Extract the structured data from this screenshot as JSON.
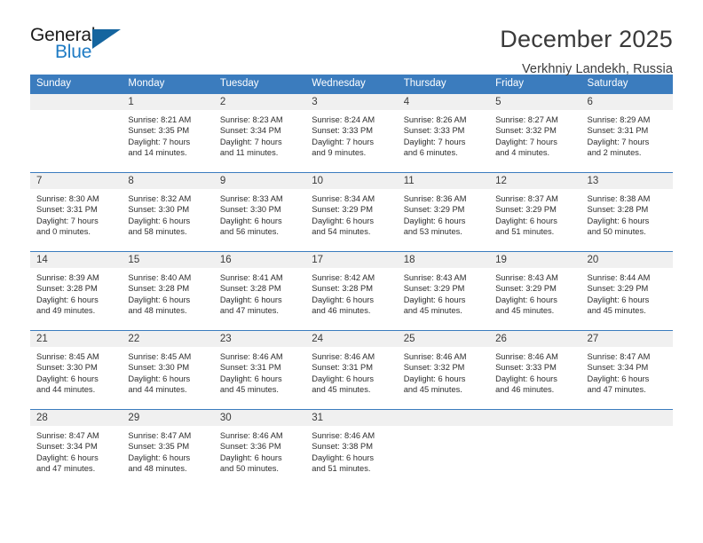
{
  "brand": {
    "name_top": "General",
    "name_bottom": "Blue",
    "accent_color": "#1e7bc4",
    "triangle_color": "#15659f"
  },
  "header": {
    "title": "December 2025",
    "subtitle": "Verkhniy Landekh, Russia"
  },
  "calendar": {
    "header_color": "#3b7cbe",
    "daynum_bg": "#f0f0f0",
    "weekday_names": [
      "Sunday",
      "Monday",
      "Tuesday",
      "Wednesday",
      "Thursday",
      "Friday",
      "Saturday"
    ],
    "weeks": [
      [
        {
          "day": "",
          "sunrise": "",
          "sunset": "",
          "daylight1": "",
          "daylight2": ""
        },
        {
          "day": "1",
          "sunrise": "Sunrise: 8:21 AM",
          "sunset": "Sunset: 3:35 PM",
          "daylight1": "Daylight: 7 hours",
          "daylight2": "and 14 minutes."
        },
        {
          "day": "2",
          "sunrise": "Sunrise: 8:23 AM",
          "sunset": "Sunset: 3:34 PM",
          "daylight1": "Daylight: 7 hours",
          "daylight2": "and 11 minutes."
        },
        {
          "day": "3",
          "sunrise": "Sunrise: 8:24 AM",
          "sunset": "Sunset: 3:33 PM",
          "daylight1": "Daylight: 7 hours",
          "daylight2": "and 9 minutes."
        },
        {
          "day": "4",
          "sunrise": "Sunrise: 8:26 AM",
          "sunset": "Sunset: 3:33 PM",
          "daylight1": "Daylight: 7 hours",
          "daylight2": "and 6 minutes."
        },
        {
          "day": "5",
          "sunrise": "Sunrise: 8:27 AM",
          "sunset": "Sunset: 3:32 PM",
          "daylight1": "Daylight: 7 hours",
          "daylight2": "and 4 minutes."
        },
        {
          "day": "6",
          "sunrise": "Sunrise: 8:29 AM",
          "sunset": "Sunset: 3:31 PM",
          "daylight1": "Daylight: 7 hours",
          "daylight2": "and 2 minutes."
        }
      ],
      [
        {
          "day": "7",
          "sunrise": "Sunrise: 8:30 AM",
          "sunset": "Sunset: 3:31 PM",
          "daylight1": "Daylight: 7 hours",
          "daylight2": "and 0 minutes."
        },
        {
          "day": "8",
          "sunrise": "Sunrise: 8:32 AM",
          "sunset": "Sunset: 3:30 PM",
          "daylight1": "Daylight: 6 hours",
          "daylight2": "and 58 minutes."
        },
        {
          "day": "9",
          "sunrise": "Sunrise: 8:33 AM",
          "sunset": "Sunset: 3:30 PM",
          "daylight1": "Daylight: 6 hours",
          "daylight2": "and 56 minutes."
        },
        {
          "day": "10",
          "sunrise": "Sunrise: 8:34 AM",
          "sunset": "Sunset: 3:29 PM",
          "daylight1": "Daylight: 6 hours",
          "daylight2": "and 54 minutes."
        },
        {
          "day": "11",
          "sunrise": "Sunrise: 8:36 AM",
          "sunset": "Sunset: 3:29 PM",
          "daylight1": "Daylight: 6 hours",
          "daylight2": "and 53 minutes."
        },
        {
          "day": "12",
          "sunrise": "Sunrise: 8:37 AM",
          "sunset": "Sunset: 3:29 PM",
          "daylight1": "Daylight: 6 hours",
          "daylight2": "and 51 minutes."
        },
        {
          "day": "13",
          "sunrise": "Sunrise: 8:38 AM",
          "sunset": "Sunset: 3:28 PM",
          "daylight1": "Daylight: 6 hours",
          "daylight2": "and 50 minutes."
        }
      ],
      [
        {
          "day": "14",
          "sunrise": "Sunrise: 8:39 AM",
          "sunset": "Sunset: 3:28 PM",
          "daylight1": "Daylight: 6 hours",
          "daylight2": "and 49 minutes."
        },
        {
          "day": "15",
          "sunrise": "Sunrise: 8:40 AM",
          "sunset": "Sunset: 3:28 PM",
          "daylight1": "Daylight: 6 hours",
          "daylight2": "and 48 minutes."
        },
        {
          "day": "16",
          "sunrise": "Sunrise: 8:41 AM",
          "sunset": "Sunset: 3:28 PM",
          "daylight1": "Daylight: 6 hours",
          "daylight2": "and 47 minutes."
        },
        {
          "day": "17",
          "sunrise": "Sunrise: 8:42 AM",
          "sunset": "Sunset: 3:28 PM",
          "daylight1": "Daylight: 6 hours",
          "daylight2": "and 46 minutes."
        },
        {
          "day": "18",
          "sunrise": "Sunrise: 8:43 AM",
          "sunset": "Sunset: 3:29 PM",
          "daylight1": "Daylight: 6 hours",
          "daylight2": "and 45 minutes."
        },
        {
          "day": "19",
          "sunrise": "Sunrise: 8:43 AM",
          "sunset": "Sunset: 3:29 PM",
          "daylight1": "Daylight: 6 hours",
          "daylight2": "and 45 minutes."
        },
        {
          "day": "20",
          "sunrise": "Sunrise: 8:44 AM",
          "sunset": "Sunset: 3:29 PM",
          "daylight1": "Daylight: 6 hours",
          "daylight2": "and 45 minutes."
        }
      ],
      [
        {
          "day": "21",
          "sunrise": "Sunrise: 8:45 AM",
          "sunset": "Sunset: 3:30 PM",
          "daylight1": "Daylight: 6 hours",
          "daylight2": "and 44 minutes."
        },
        {
          "day": "22",
          "sunrise": "Sunrise: 8:45 AM",
          "sunset": "Sunset: 3:30 PM",
          "daylight1": "Daylight: 6 hours",
          "daylight2": "and 44 minutes."
        },
        {
          "day": "23",
          "sunrise": "Sunrise: 8:46 AM",
          "sunset": "Sunset: 3:31 PM",
          "daylight1": "Daylight: 6 hours",
          "daylight2": "and 45 minutes."
        },
        {
          "day": "24",
          "sunrise": "Sunrise: 8:46 AM",
          "sunset": "Sunset: 3:31 PM",
          "daylight1": "Daylight: 6 hours",
          "daylight2": "and 45 minutes."
        },
        {
          "day": "25",
          "sunrise": "Sunrise: 8:46 AM",
          "sunset": "Sunset: 3:32 PM",
          "daylight1": "Daylight: 6 hours",
          "daylight2": "and 45 minutes."
        },
        {
          "day": "26",
          "sunrise": "Sunrise: 8:46 AM",
          "sunset": "Sunset: 3:33 PM",
          "daylight1": "Daylight: 6 hours",
          "daylight2": "and 46 minutes."
        },
        {
          "day": "27",
          "sunrise": "Sunrise: 8:47 AM",
          "sunset": "Sunset: 3:34 PM",
          "daylight1": "Daylight: 6 hours",
          "daylight2": "and 47 minutes."
        }
      ],
      [
        {
          "day": "28",
          "sunrise": "Sunrise: 8:47 AM",
          "sunset": "Sunset: 3:34 PM",
          "daylight1": "Daylight: 6 hours",
          "daylight2": "and 47 minutes."
        },
        {
          "day": "29",
          "sunrise": "Sunrise: 8:47 AM",
          "sunset": "Sunset: 3:35 PM",
          "daylight1": "Daylight: 6 hours",
          "daylight2": "and 48 minutes."
        },
        {
          "day": "30",
          "sunrise": "Sunrise: 8:46 AM",
          "sunset": "Sunset: 3:36 PM",
          "daylight1": "Daylight: 6 hours",
          "daylight2": "and 50 minutes."
        },
        {
          "day": "31",
          "sunrise": "Sunrise: 8:46 AM",
          "sunset": "Sunset: 3:38 PM",
          "daylight1": "Daylight: 6 hours",
          "daylight2": "and 51 minutes."
        },
        {
          "day": "",
          "sunrise": "",
          "sunset": "",
          "daylight1": "",
          "daylight2": ""
        },
        {
          "day": "",
          "sunrise": "",
          "sunset": "",
          "daylight1": "",
          "daylight2": ""
        },
        {
          "day": "",
          "sunrise": "",
          "sunset": "",
          "daylight1": "",
          "daylight2": ""
        }
      ]
    ]
  }
}
